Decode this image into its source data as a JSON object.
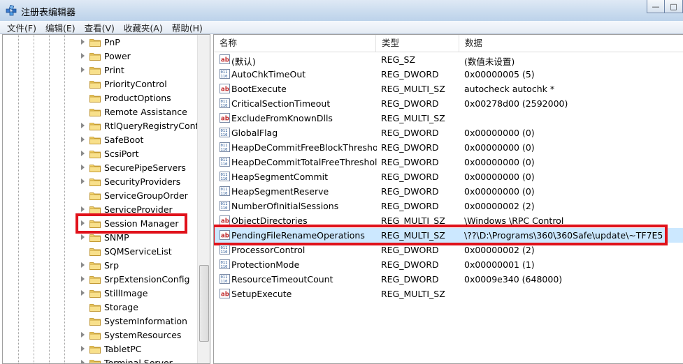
{
  "window": {
    "title": "注册表编辑器",
    "icon": "registry-editor-icon"
  },
  "menu": [
    "文件(F)",
    "编辑(E)",
    "查看(V)",
    "收藏夹(A)",
    "帮助(H)"
  ],
  "tree": {
    "items": [
      {
        "label": "PnP",
        "expandable": true
      },
      {
        "label": "Power",
        "expandable": true
      },
      {
        "label": "Print",
        "expandable": true
      },
      {
        "label": "PriorityControl",
        "expandable": false
      },
      {
        "label": "ProductOptions",
        "expandable": false
      },
      {
        "label": "Remote Assistance",
        "expandable": false
      },
      {
        "label": "RtlQueryRegistryConfig",
        "expandable": true
      },
      {
        "label": "SafeBoot",
        "expandable": true
      },
      {
        "label": "ScsiPort",
        "expandable": true
      },
      {
        "label": "SecurePipeServers",
        "expandable": true
      },
      {
        "label": "SecurityProviders",
        "expandable": true
      },
      {
        "label": "ServiceGroupOrder",
        "expandable": false
      },
      {
        "label": "ServiceProvider",
        "expandable": true
      },
      {
        "label": "Session Manager",
        "expandable": true,
        "highlighted": true
      },
      {
        "label": "SNMP",
        "expandable": true
      },
      {
        "label": "SQMServiceList",
        "expandable": false
      },
      {
        "label": "Srp",
        "expandable": true
      },
      {
        "label": "SrpExtensionConfig",
        "expandable": true
      },
      {
        "label": "StillImage",
        "expandable": true
      },
      {
        "label": "Storage",
        "expandable": false
      },
      {
        "label": "SystemInformation",
        "expandable": false
      },
      {
        "label": "SystemResources",
        "expandable": true
      },
      {
        "label": "TabletPC",
        "expandable": true
      },
      {
        "label": "Terminal Server",
        "expandable": true
      }
    ]
  },
  "list": {
    "columns": [
      "名称",
      "类型",
      "数据"
    ],
    "rows": [
      {
        "name": "(默认)",
        "type": "REG_SZ",
        "data": "(数值未设置)",
        "icon": "string-value-icon"
      },
      {
        "name": "AutoChkTimeOut",
        "type": "REG_DWORD",
        "data": "0x00000005 (5)",
        "icon": "binary-value-icon"
      },
      {
        "name": "BootExecute",
        "type": "REG_MULTI_SZ",
        "data": "autocheck autochk *",
        "icon": "string-value-icon"
      },
      {
        "name": "CriticalSectionTimeout",
        "type": "REG_DWORD",
        "data": "0x00278d00 (2592000)",
        "icon": "binary-value-icon"
      },
      {
        "name": "ExcludeFromKnownDlls",
        "type": "REG_MULTI_SZ",
        "data": "",
        "icon": "string-value-icon"
      },
      {
        "name": "GlobalFlag",
        "type": "REG_DWORD",
        "data": "0x00000000 (0)",
        "icon": "binary-value-icon"
      },
      {
        "name": "HeapDeCommitFreeBlockThresho...",
        "type": "REG_DWORD",
        "data": "0x00000000 (0)",
        "icon": "binary-value-icon"
      },
      {
        "name": "HeapDeCommitTotalFreeThreshold",
        "type": "REG_DWORD",
        "data": "0x00000000 (0)",
        "icon": "binary-value-icon"
      },
      {
        "name": "HeapSegmentCommit",
        "type": "REG_DWORD",
        "data": "0x00000000 (0)",
        "icon": "binary-value-icon"
      },
      {
        "name": "HeapSegmentReserve",
        "type": "REG_DWORD",
        "data": "0x00000000 (0)",
        "icon": "binary-value-icon"
      },
      {
        "name": "NumberOfInitialSessions",
        "type": "REG_DWORD",
        "data": "0x00000002 (2)",
        "icon": "binary-value-icon"
      },
      {
        "name": "ObjectDirectories",
        "type": "REG_MULTI_SZ",
        "data": "\\Windows \\RPC Control",
        "icon": "string-value-icon"
      },
      {
        "name": "PendingFileRenameOperations",
        "type": "REG_MULTI_SZ",
        "data": "\\??\\D:\\Programs\\360\\360Safe\\update\\~TF7E5...",
        "icon": "string-value-icon",
        "highlighted": true,
        "selected": true
      },
      {
        "name": "ProcessorControl",
        "type": "REG_DWORD",
        "data": "0x00000002 (2)",
        "icon": "binary-value-icon"
      },
      {
        "name": "ProtectionMode",
        "type": "REG_DWORD",
        "data": "0x00000001 (1)",
        "icon": "binary-value-icon"
      },
      {
        "name": "ResourceTimeoutCount",
        "type": "REG_DWORD",
        "data": "0x0009e340 (648000)",
        "icon": "binary-value-icon"
      },
      {
        "name": "SetupExecute",
        "type": "REG_MULTI_SZ",
        "data": "",
        "icon": "string-value-icon"
      }
    ]
  },
  "colors": {
    "highlight": "#e0121b",
    "selected_row": "#cce8ff"
  }
}
